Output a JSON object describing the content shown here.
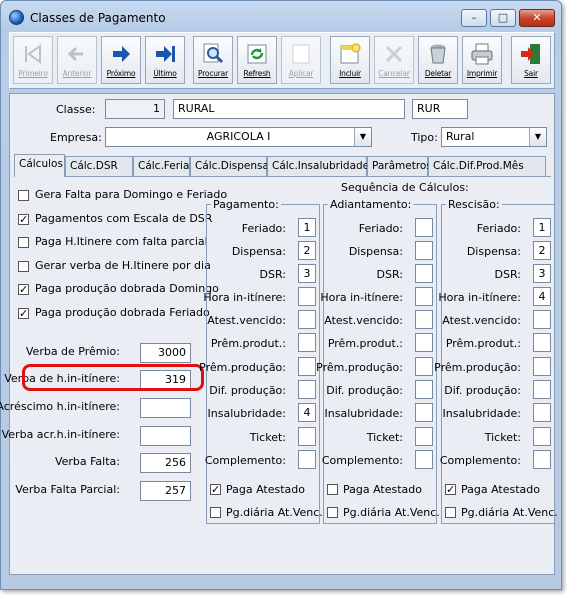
{
  "window": {
    "title": "Classes de Pagamento"
  },
  "toolbar": [
    {
      "label": "Primeiro",
      "enabled": false,
      "icon": "first-icon"
    },
    {
      "label": "Anterior",
      "enabled": false,
      "icon": "previous-icon"
    },
    {
      "label": "Próximo",
      "enabled": true,
      "icon": "next-icon"
    },
    {
      "label": "Último",
      "enabled": true,
      "icon": "last-icon"
    },
    {
      "label": "Procurar",
      "enabled": true,
      "icon": "search-icon"
    },
    {
      "label": "Refresh",
      "enabled": true,
      "icon": "refresh-icon"
    },
    {
      "label": "Aplicar",
      "enabled": false,
      "icon": "apply-icon"
    },
    {
      "label": "Incluir",
      "enabled": true,
      "icon": "add-icon"
    },
    {
      "label": "Cancelar",
      "enabled": false,
      "icon": "cancel-icon"
    },
    {
      "label": "Deletar",
      "enabled": true,
      "icon": "delete-icon"
    },
    {
      "label": "Imprimir",
      "enabled": true,
      "icon": "print-icon"
    },
    {
      "label": "Sair",
      "enabled": true,
      "icon": "exit-icon"
    }
  ],
  "form": {
    "classe_label": "Classe:",
    "classe_code": "1",
    "classe_name": "RURAL",
    "classe_abbr": "RUR",
    "empresa_label": "Empresa:",
    "empresa_value": "AGRICOLA I",
    "tipo_label": "Tipo:",
    "tipo_value": "Rural"
  },
  "tabs": [
    "Cálculos",
    "Cálc.DSR",
    "Cálc.Feriado",
    "Cálc.Dispensa",
    "Cálc.Insalubridade",
    "Parâmetros",
    "Cálc.Dif.Prod.Mês"
  ],
  "options": [
    {
      "label": "Gera Falta para Domingo e Feriado",
      "checked": false
    },
    {
      "label": "Pagamentos com Escala de DSR",
      "checked": true
    },
    {
      "label": "Paga H.Itinere com falta parcial",
      "checked": false
    },
    {
      "label": "Gerar verba de H.Itinere por dia",
      "checked": false
    },
    {
      "label": "Paga produção dobrada Domingo",
      "checked": true
    },
    {
      "label": "Paga produção dobrada Feriado",
      "checked": true
    }
  ],
  "verbas": [
    {
      "label": "Verba de Prêmio:",
      "value": "3000"
    },
    {
      "label": "Verba de h.in-itínere:",
      "value": "319"
    },
    {
      "label": "Acréscimo h.in-itínere:",
      "value": ""
    },
    {
      "label": "Verba acr.h.in-itínere:",
      "value": ""
    },
    {
      "label": "Verba Falta:",
      "value": "256"
    },
    {
      "label": "Verba Falta Parcial:",
      "value": "257"
    }
  ],
  "sequence": {
    "title": "Sequência de Cálculos:",
    "rows": [
      "Feriado:",
      "Dispensa:",
      "DSR:",
      "Hora in-itínere:",
      "Atest.vencido:",
      "Prêm.produt.:",
      "Prêm.produção:",
      "Dif. produção:",
      "Insalubridade:",
      "Ticket:",
      "Complemento:"
    ],
    "groups": [
      {
        "title": "Pagamento:",
        "values": [
          "1",
          "2",
          "3",
          "",
          "",
          "",
          "",
          "",
          "4",
          "",
          ""
        ],
        "paga_atestado": true,
        "pg_diaria": false
      },
      {
        "title": "Adiantamento:",
        "values": [
          "",
          "",
          "",
          "",
          "",
          "",
          "",
          "",
          "",
          "",
          ""
        ],
        "paga_atestado": false,
        "pg_diaria": false
      },
      {
        "title": "Rescisão:",
        "values": [
          "1",
          "2",
          "3",
          "4",
          "",
          "",
          "",
          "",
          "",
          "",
          ""
        ],
        "paga_atestado": true,
        "pg_diaria": false
      }
    ],
    "paga_atestado_label": "Paga Atestado",
    "pg_diaria_label": "Pg.diária At.Venc."
  }
}
